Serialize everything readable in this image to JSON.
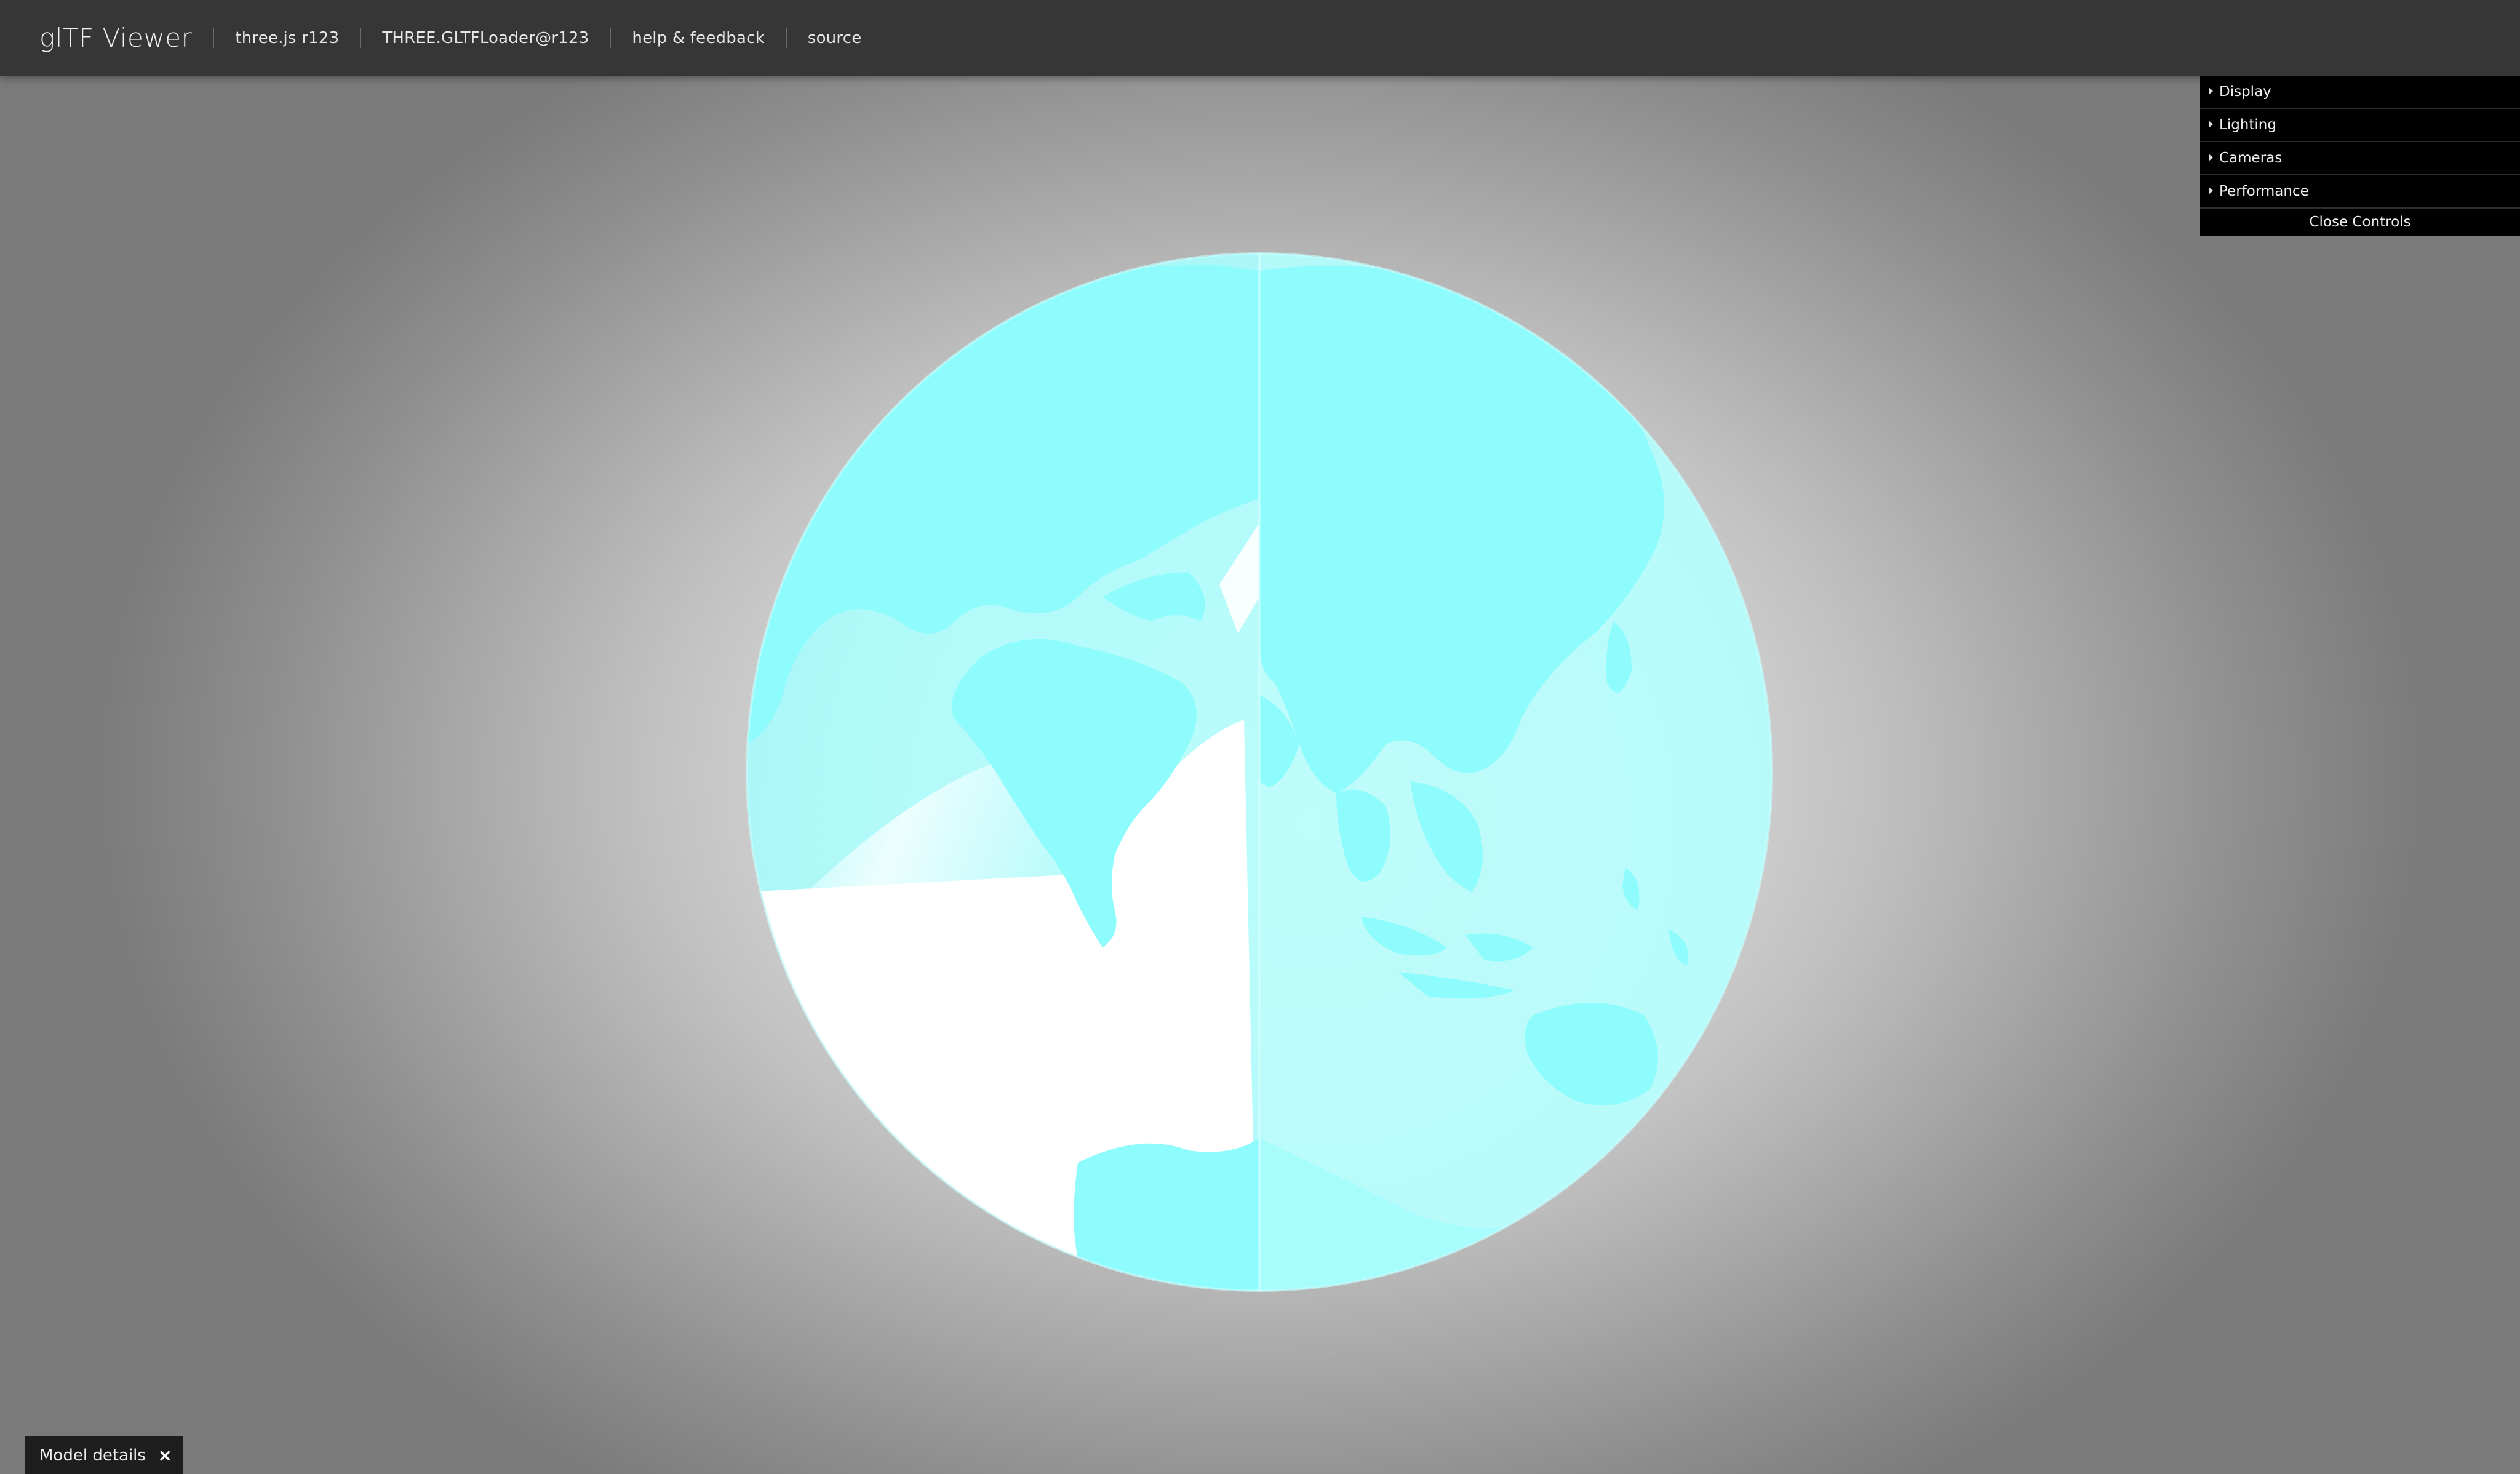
{
  "header": {
    "title": "glTF Viewer",
    "links": [
      "three.js r123",
      "THREE.GLTFLoader@r123",
      "help & feedback",
      "source"
    ]
  },
  "controls": {
    "folders": [
      "Display",
      "Lighting",
      "Cameras",
      "Performance"
    ],
    "close_label": "Close Controls"
  },
  "model_details": {
    "label": "Model details",
    "close_glyph": "×"
  },
  "colors": {
    "header_bg": "#363636",
    "globe_ocean": "#b7fbfb",
    "globe_land": "#8efcfc",
    "controls_bg": "#000000"
  },
  "icons": {
    "folder_caret": "caret-right-icon",
    "close": "close-icon"
  }
}
